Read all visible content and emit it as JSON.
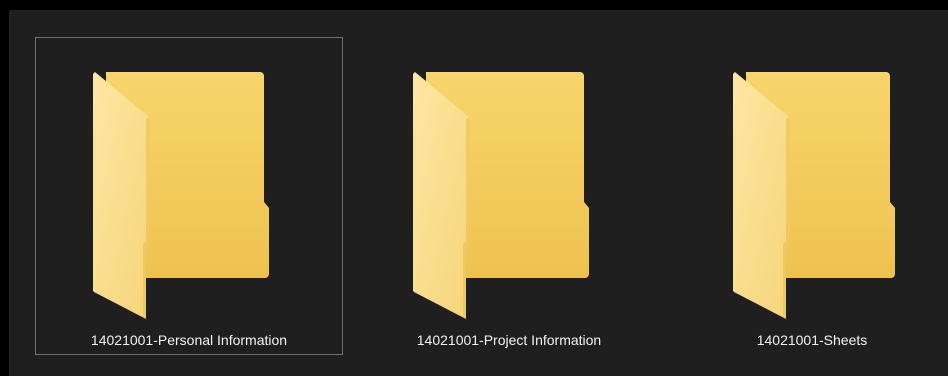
{
  "explorer": {
    "items": [
      {
        "name": "14021001-Personal Information",
        "selected": true,
        "icon": "folder-icon"
      },
      {
        "name": "14021001-Project Information",
        "selected": false,
        "icon": "folder-icon"
      },
      {
        "name": "14021001-Sheets",
        "selected": false,
        "icon": "folder-icon"
      }
    ]
  },
  "colors": {
    "background": "#1f1f1f",
    "folder_back": "#f3cd5e",
    "folder_front": "#fbe49b",
    "selection_border": "#6f6f6f",
    "label_text": "#f2f2f2"
  }
}
